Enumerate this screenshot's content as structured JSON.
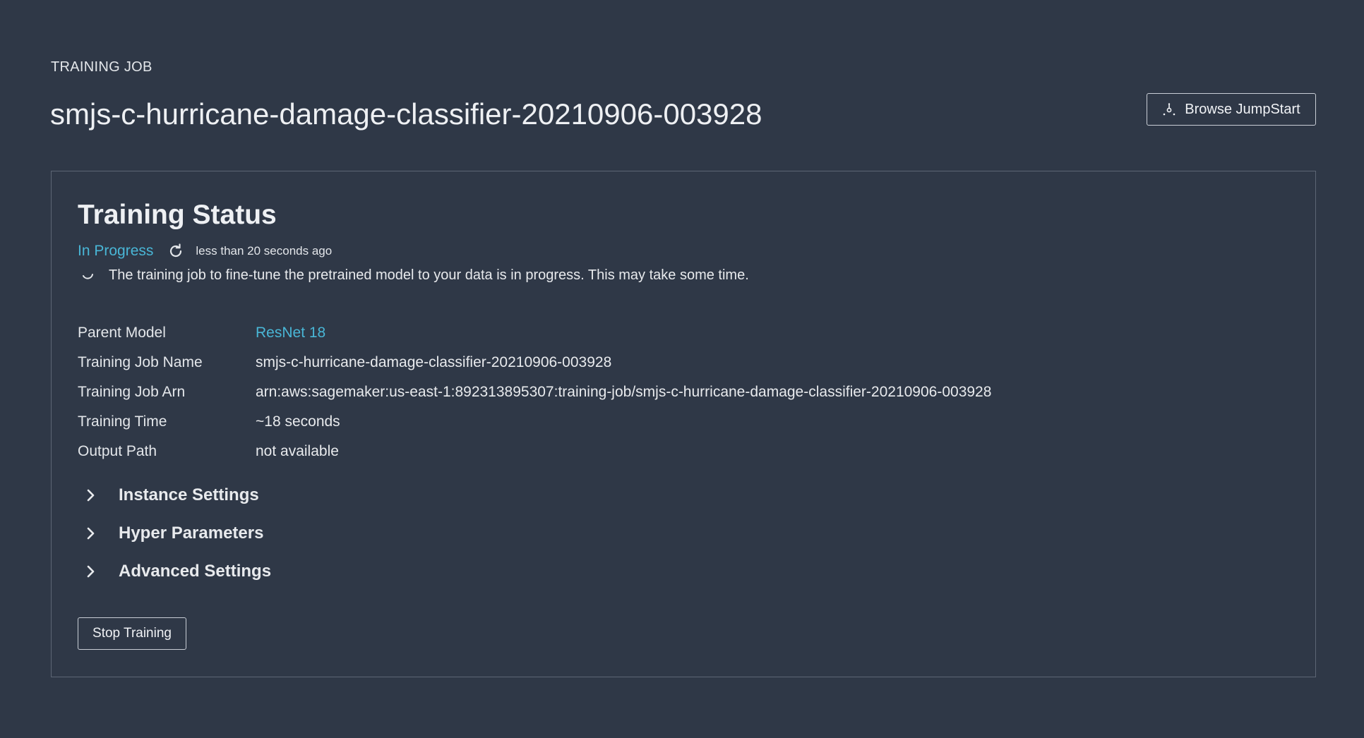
{
  "header": {
    "eyebrow": "TRAINING JOB",
    "job_title": "smjs-c-hurricane-damage-classifier-20210906-003928",
    "browse_button_label": "Browse JumpStart",
    "browse_icon": "jumpstart-icon"
  },
  "status_panel": {
    "title": "Training Status",
    "status": "In Progress",
    "status_color": "#49b6d6",
    "refresh_icon": "refresh-icon",
    "updated": "less than 20 seconds ago",
    "progress_icon": "spinner-icon",
    "progress_message": "The training job to fine-tune the pretrained model to your data is in progress. This may take some time.",
    "details": [
      {
        "label": "Parent Model",
        "value": "ResNet 18"
      },
      {
        "label": "Training Job Name",
        "value": "smjs-c-hurricane-damage-classifier-20210906-003928"
      },
      {
        "label": "Training Job Arn",
        "value": "arn:aws:sagemaker:us-east-1:892313895307:training-job/smjs-c-hurricane-damage-classifier-20210906-003928"
      },
      {
        "label": "Training Time",
        "value": "~18 seconds"
      },
      {
        "label": "Output Path",
        "value": "not available"
      }
    ],
    "sections": [
      {
        "label": "Instance Settings",
        "icon": "chevron-right-icon"
      },
      {
        "label": "Hyper Parameters",
        "icon": "chevron-right-icon"
      },
      {
        "label": "Advanced Settings",
        "icon": "chevron-right-icon"
      }
    ],
    "stop_button_label": "Stop Training"
  },
  "colors": {
    "background": "#2f3847",
    "link": "#49b6d6",
    "border": "#5d6675"
  }
}
